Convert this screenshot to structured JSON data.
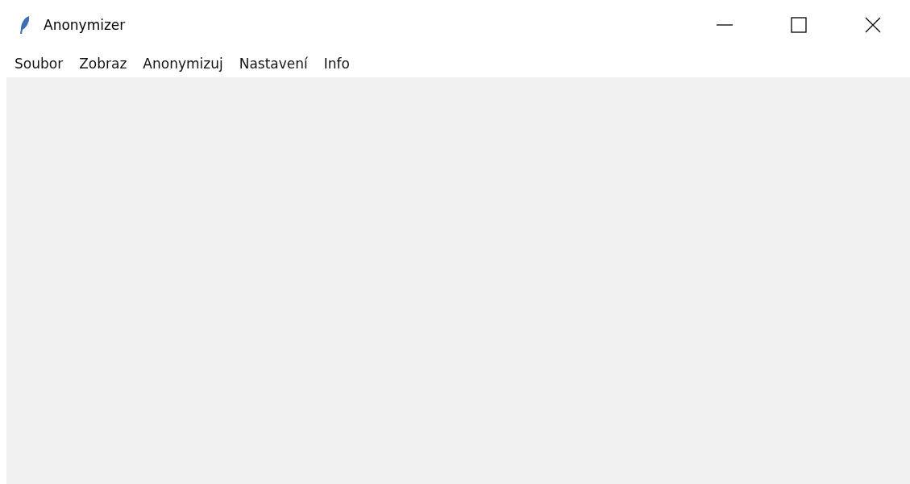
{
  "window": {
    "title": "Anonymizer"
  },
  "menu": [
    {
      "label": "Soubor"
    },
    {
      "label": "Zobraz"
    },
    {
      "label": "Anonymizuj"
    },
    {
      "label": "Nastavení"
    },
    {
      "label": "Info"
    }
  ]
}
